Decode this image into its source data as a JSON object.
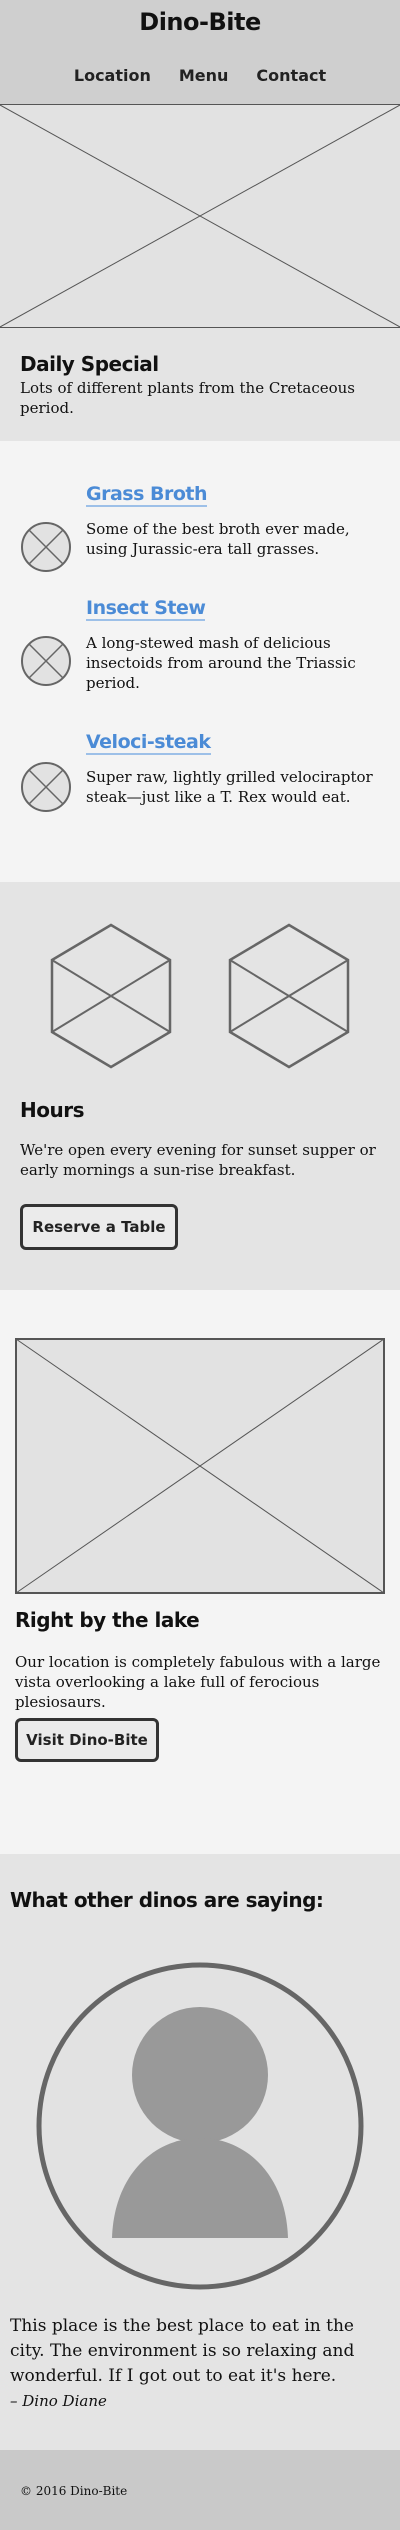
{
  "header": {
    "title": "Dino-Bite",
    "nav": [
      "Location",
      "Menu",
      "Contact"
    ]
  },
  "daily_special": {
    "title": "Daily Special",
    "description": "Lots of different plants from the Cretaceous period."
  },
  "menu": {
    "items": [
      {
        "name": "Grass Broth",
        "description": "Some of the best broth ever made, using Jurassic-era tall grasses."
      },
      {
        "name": "Insect Stew",
        "description": "A long-stewed mash of delicious insectoids from around the Triassic period."
      },
      {
        "name": "Veloci-steak",
        "description": "Super raw, lightly grilled velociraptor steak—just like a T. Rex would eat."
      }
    ]
  },
  "hours": {
    "title": "Hours",
    "description": "We're open every evening for sunset supper or early mornings a sun-rise breakfast.",
    "button_label": "Reserve a Table"
  },
  "location": {
    "title": "Right by the lake",
    "description": "Our location is completely fabulous with a large vista overlooking a lake full of ferocious plesiosaurs.",
    "button_label": "Visit Dino-Bite"
  },
  "testimonials": {
    "title": "What other dinos are saying:",
    "quote": "This place is the best place to eat in the city. The environment is so relaxing and wonderful. If I got out to eat it's here.",
    "author": "– Dino Diane"
  },
  "footer": {
    "copyright": "© 2016 Dino-Bite"
  },
  "colors": {
    "link": "#4b8bd6",
    "header_bg": "#cfcfcf",
    "light_bg": "#f4f4f4",
    "mid_bg": "#e4e4e4",
    "footer_bg": "#c9c9c9"
  }
}
